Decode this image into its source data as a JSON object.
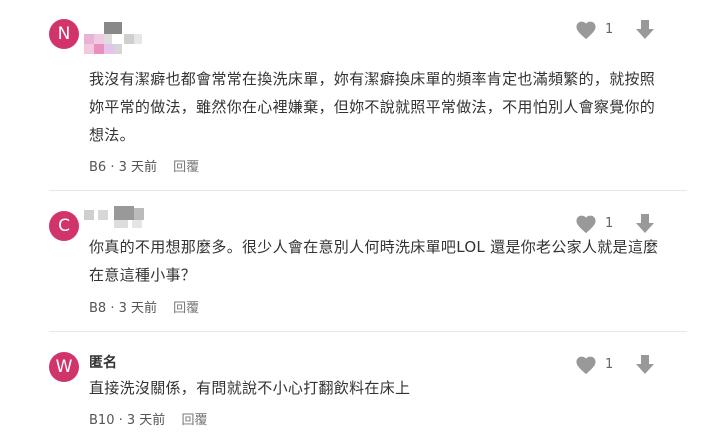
{
  "comments": [
    {
      "avatar_letter": "N",
      "author": "",
      "text": "我沒有潔癖也都會常常在換洗床單，妳有潔癖換床單的頻率肯定也滿頻繁的，就按照妳平常的做法，雖然你在心裡嫌棄，但妳不說就照平常做法，不用怕別人會察覺你的想法。",
      "floor": "B6",
      "time": "3 天前",
      "reply_label": "回覆",
      "likes": "1"
    },
    {
      "avatar_letter": "C",
      "author": "",
      "text": "你真的不用想那麼多。很少人會在意別人何時洗床單吧LOL 還是你老公家人就是這麼在意這種小事？",
      "floor": "B8",
      "time": "3 天前",
      "reply_label": "回覆",
      "likes": "1"
    },
    {
      "avatar_letter": "W",
      "author": "匿名",
      "text": "直接洗沒關係，有問就說不小心打翻飲料在床上",
      "floor": "B10",
      "time": "3 天前",
      "reply_label": "回覆",
      "likes": "1"
    }
  ],
  "colors": {
    "avatar": "#d1346b",
    "icon": "#999999"
  },
  "icons": {
    "like": "heart-icon",
    "down": "down-arrow-icon"
  }
}
